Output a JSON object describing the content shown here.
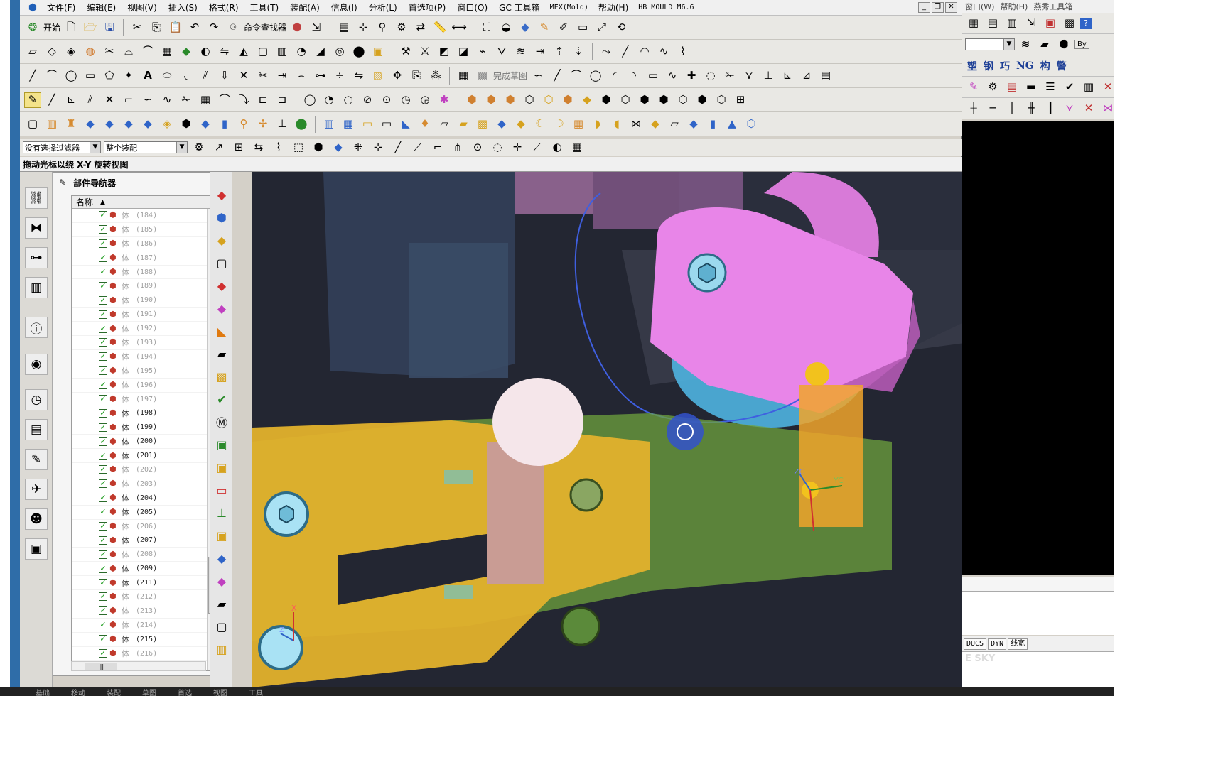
{
  "menubar": {
    "items": [
      "文件(F)",
      "编辑(E)",
      "视图(V)",
      "插入(S)",
      "格式(R)",
      "工具(T)",
      "装配(A)",
      "信息(I)",
      "分析(L)",
      "首选项(P)",
      "窗口(O)",
      "GC 工具箱"
    ],
    "mex": "MEX(Mold)",
    "help": "帮助(H)",
    "hb": "HB_MOULD M6.6"
  },
  "toolbar": {
    "start": "开始",
    "command_finder": "命令查找器",
    "finish_sketch": "完成草图"
  },
  "selection": {
    "filter": "没有选择过滤器",
    "scope": "整个装配"
  },
  "status": {
    "message": "拖动光标以绕 X-Y 旋转视图"
  },
  "navigator": {
    "title": "部件导航器",
    "column_name": "名称"
  },
  "rows": [
    {
      "label": "体",
      "num": "(184)",
      "dim": true
    },
    {
      "label": "体",
      "num": "(185)",
      "dim": true
    },
    {
      "label": "体",
      "num": "(186)",
      "dim": true
    },
    {
      "label": "体",
      "num": "(187)",
      "dim": true
    },
    {
      "label": "体",
      "num": "(188)",
      "dim": true
    },
    {
      "label": "体",
      "num": "(189)",
      "dim": true
    },
    {
      "label": "体",
      "num": "(190)",
      "dim": true
    },
    {
      "label": "体",
      "num": "(191)",
      "dim": true
    },
    {
      "label": "体",
      "num": "(192)",
      "dim": true
    },
    {
      "label": "体",
      "num": "(193)",
      "dim": true
    },
    {
      "label": "体",
      "num": "(194)",
      "dim": true
    },
    {
      "label": "体",
      "num": "(195)",
      "dim": true
    },
    {
      "label": "体",
      "num": "(196)",
      "dim": true
    },
    {
      "label": "体",
      "num": "(197)",
      "dim": true
    },
    {
      "label": "体",
      "num": "(198)",
      "dim": false
    },
    {
      "label": "体",
      "num": "(199)",
      "dim": false
    },
    {
      "label": "体",
      "num": "(200)",
      "dim": false
    },
    {
      "label": "体",
      "num": "(201)",
      "dim": false
    },
    {
      "label": "体",
      "num": "(202)",
      "dim": true
    },
    {
      "label": "体",
      "num": "(203)",
      "dim": true
    },
    {
      "label": "体",
      "num": "(204)",
      "dim": false
    },
    {
      "label": "体",
      "num": "(205)",
      "dim": false
    },
    {
      "label": "体",
      "num": "(206)",
      "dim": true
    },
    {
      "label": "体",
      "num": "(207)",
      "dim": false
    },
    {
      "label": "体",
      "num": "(208)",
      "dim": true
    },
    {
      "label": "体",
      "num": "(209)",
      "dim": false
    },
    {
      "label": "体",
      "num": "(211)",
      "dim": false
    },
    {
      "label": "体",
      "num": "(212)",
      "dim": true
    },
    {
      "label": "体",
      "num": "(213)",
      "dim": true
    },
    {
      "label": "体",
      "num": "(214)",
      "dim": true
    },
    {
      "label": "体",
      "num": "(215)",
      "dim": false
    },
    {
      "label": "体",
      "num": "(216)",
      "dim": true
    }
  ],
  "viewport": {
    "axis_zc": "ZC",
    "axis_yc": "YC",
    "triad_z": "Z",
    "triad_x": "X"
  },
  "rightwin": {
    "menu": [
      "窗口(W)",
      "帮助(H)",
      "燕秀工具箱"
    ],
    "labels": [
      "塑",
      "钢",
      "巧",
      "NG",
      "构",
      "警"
    ],
    "status": [
      "DUCS",
      "DYN",
      "线宽"
    ],
    "sky": "E SKY",
    "combo_tag": "By"
  },
  "bottom": {
    "items": [
      "基础",
      "移动",
      "装配",
      "草图",
      "首选",
      "视图",
      "工具"
    ]
  }
}
